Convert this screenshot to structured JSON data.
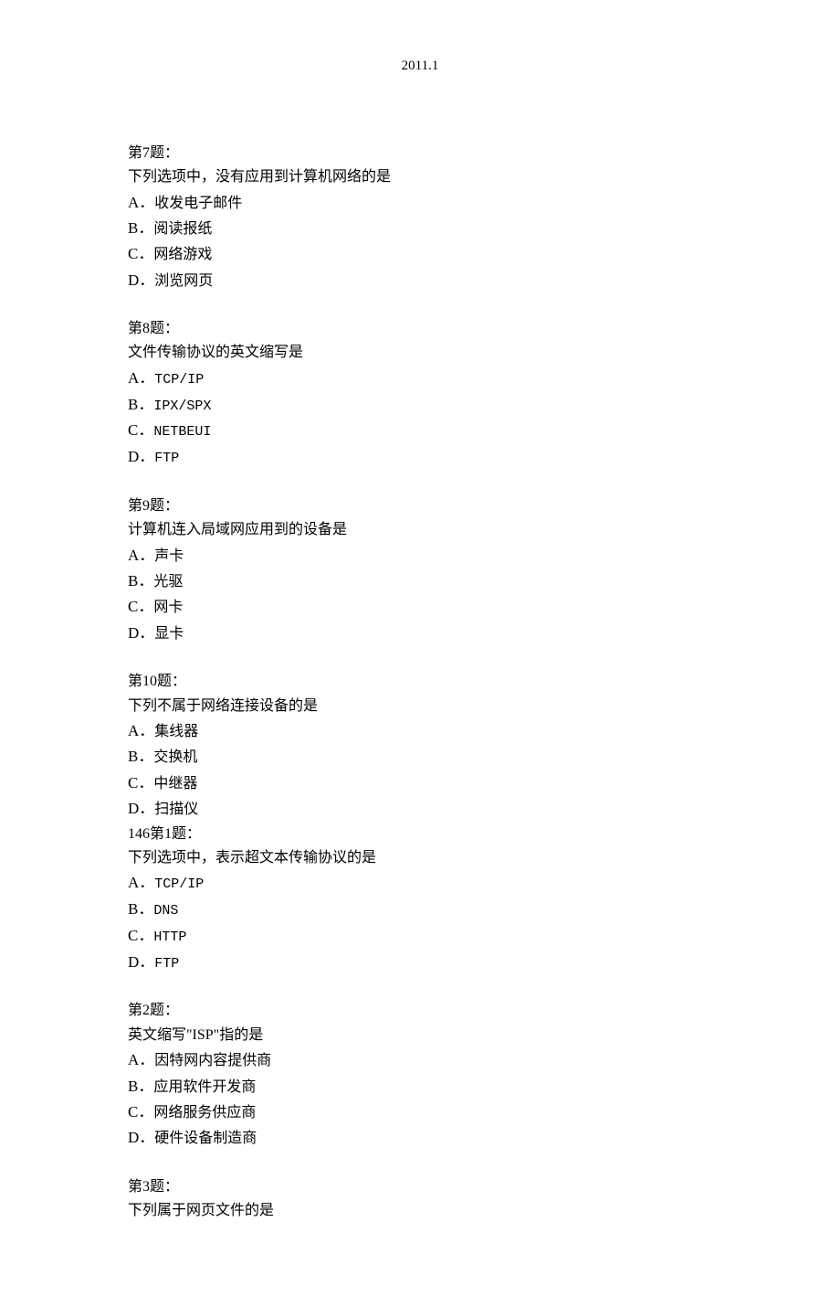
{
  "header": "2011.1",
  "questions": [
    {
      "title": "第7题：",
      "prompt": "下列选项中，没有应用到计算机网络的是",
      "options": [
        {
          "letter": "A．",
          "text": "收发电子邮件",
          "mono": false
        },
        {
          "letter": "B．",
          "text": "阅读报纸",
          "mono": false
        },
        {
          "letter": "C．",
          "text": "网络游戏",
          "mono": false
        },
        {
          "letter": "D．",
          "text": "浏览网页",
          "mono": false
        }
      ]
    },
    {
      "title": "第8题：",
      "prompt": "文件传输协议的英文缩写是",
      "options": [
        {
          "letter": "A．",
          "text": "TCP/IP",
          "mono": true
        },
        {
          "letter": "B．",
          "text": "IPX/SPX",
          "mono": true
        },
        {
          "letter": "C．",
          "text": "NETBEUI",
          "mono": true
        },
        {
          "letter": "D．",
          "text": "FTP",
          "mono": true
        }
      ]
    },
    {
      "title": "第9题：",
      "prompt": "计算机连入局域网应用到的设备是",
      "options": [
        {
          "letter": "A．",
          "text": "声卡",
          "mono": false
        },
        {
          "letter": "B．",
          "text": "光驱",
          "mono": false
        },
        {
          "letter": "C．",
          "text": "网卡",
          "mono": false
        },
        {
          "letter": "D．",
          "text": "显卡",
          "mono": false
        }
      ]
    },
    {
      "title": "第10题：",
      "prompt": "下列不属于网络连接设备的是",
      "options": [
        {
          "letter": "A．",
          "text": "集线器",
          "mono": false
        },
        {
          "letter": "B．",
          "text": "交换机",
          "mono": false
        },
        {
          "letter": "C．",
          "text": "中继器",
          "mono": false
        },
        {
          "letter": "D．",
          "text": "扫描仪",
          "mono": false
        }
      ],
      "trailing": {
        "title": "146第1题：",
        "prompt": "下列选项中，表示超文本传输协议的是",
        "options": [
          {
            "letter": "A．",
            "text": "TCP/IP",
            "mono": true
          },
          {
            "letter": "B．",
            "text": "DNS",
            "mono": true
          },
          {
            "letter": "C．",
            "text": "HTTP",
            "mono": true
          },
          {
            "letter": "D．",
            "text": "FTP",
            "mono": true
          }
        ]
      }
    },
    {
      "title": "第2题：",
      "prompt": "英文缩写\"ISP\"指的是",
      "options": [
        {
          "letter": "A．",
          "text": "因特网内容提供商",
          "mono": false
        },
        {
          "letter": "B．",
          "text": "应用软件开发商",
          "mono": false
        },
        {
          "letter": "C．",
          "text": "网络服务供应商",
          "mono": false
        },
        {
          "letter": "D．",
          "text": "硬件设备制造商",
          "mono": false
        }
      ]
    },
    {
      "title": "第3题：",
      "prompt": "下列属于网页文件的是",
      "options": []
    }
  ]
}
